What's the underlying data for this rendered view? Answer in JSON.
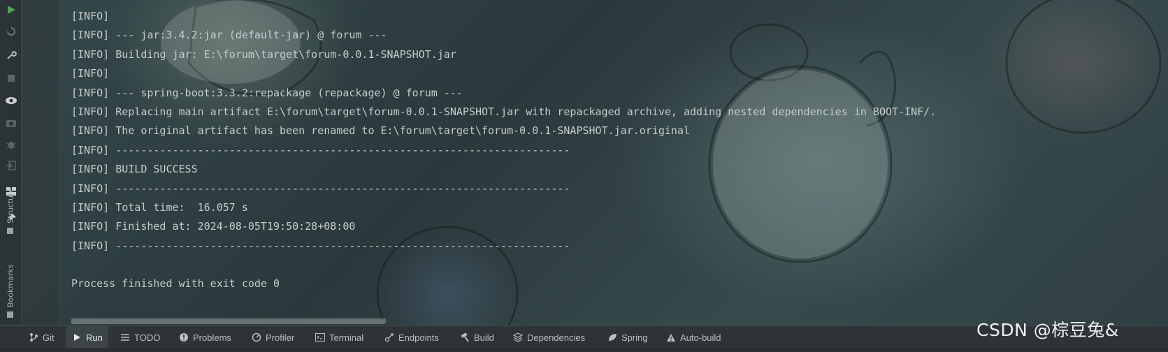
{
  "console": {
    "lines": [
      "[INFO]",
      "[INFO] --- jar:3.4.2:jar (default-jar) @ forum ---",
      "[INFO] Building jar: E:\\forum\\target\\forum-0.0.1-SNAPSHOT.jar",
      "[INFO]",
      "[INFO] --- spring-boot:3.3.2:repackage (repackage) @ forum ---",
      "[INFO] Replacing main artifact E:\\forum\\target\\forum-0.0.1-SNAPSHOT.jar with repackaged archive, adding nested dependencies in BOOT-INF/.",
      "[INFO] The original artifact has been renamed to E:\\forum\\target\\forum-0.0.1-SNAPSHOT.jar.original",
      "[INFO] ------------------------------------------------------------------------",
      "[INFO] BUILD SUCCESS",
      "[INFO] ------------------------------------------------------------------------",
      "[INFO] Total time:  16.057 s",
      "[INFO] Finished at: 2024-08-05T19:50:28+08:00",
      "[INFO] ------------------------------------------------------------------------",
      "",
      "Process finished with exit code 0"
    ]
  },
  "left_strip": {
    "structure_label": "Structure",
    "bookmarks_label": "Bookmarks",
    "icons": [
      "run-icon",
      "rerun-icon",
      "wrench-icon",
      "stop-icon",
      "eye-icon",
      "camera-icon",
      "debug-icon",
      "exit-icon",
      "layout-icon",
      "pin-icon"
    ]
  },
  "bottom_bar": {
    "tabs": [
      {
        "label": "Git",
        "icon": "git-icon"
      },
      {
        "label": "Run",
        "icon": "run-icon",
        "active": true
      },
      {
        "label": "TODO",
        "icon": "todo-icon"
      },
      {
        "label": "Problems",
        "icon": "problems-icon"
      },
      {
        "label": "Profiler",
        "icon": "profiler-icon"
      },
      {
        "label": "Terminal",
        "icon": "terminal-icon"
      },
      {
        "label": "Endpoints",
        "icon": "endpoints-icon"
      },
      {
        "label": "Build",
        "icon": "hammer-icon"
      },
      {
        "label": "Dependencies",
        "icon": "dependencies-icon"
      },
      {
        "label": "Spring",
        "icon": "spring-icon"
      },
      {
        "label": "Auto-build",
        "icon": "warning-icon"
      }
    ]
  },
  "watermark": "CSDN @棕豆兔&",
  "colors": {
    "run_green": "#4fa35a",
    "console_text": "#c6ccce",
    "bar_bg": "#2e3436"
  }
}
